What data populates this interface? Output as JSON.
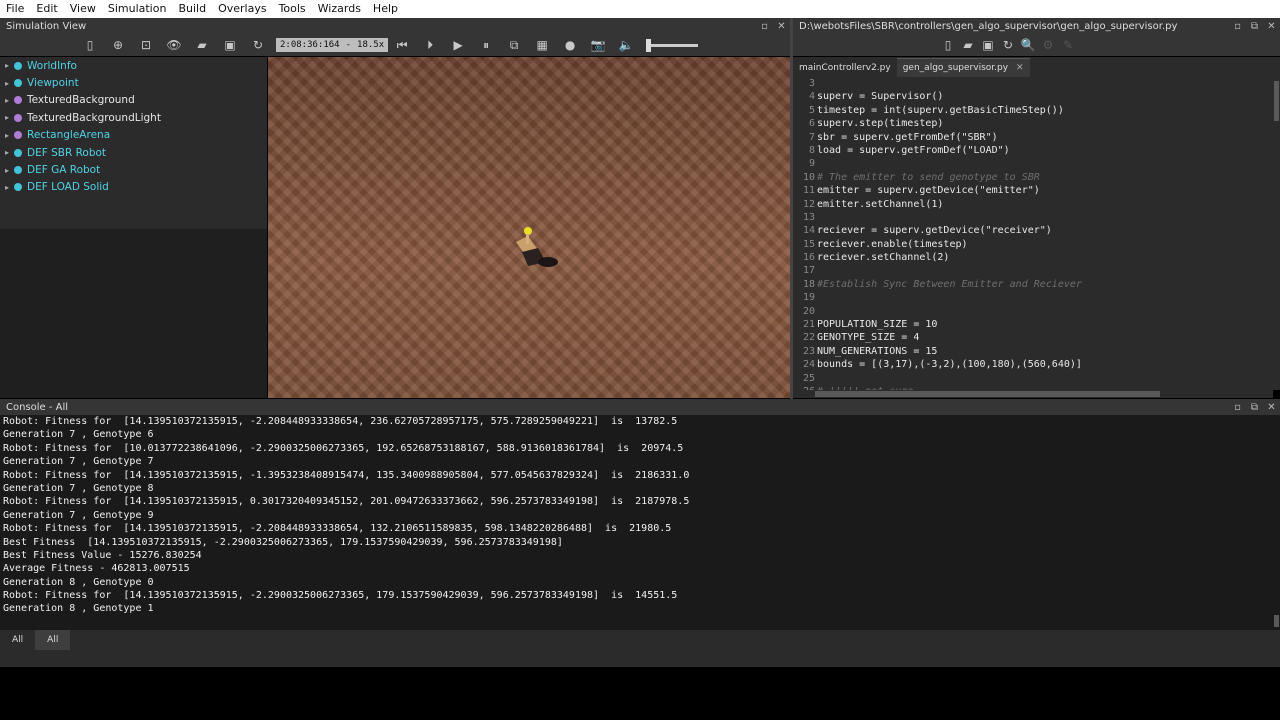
{
  "menubar": [
    "File",
    "Edit",
    "View",
    "Simulation",
    "Build",
    "Overlays",
    "Tools",
    "Wizards",
    "Help"
  ],
  "simulation_view": {
    "title": "Simulation View",
    "time": "2:08:36:164",
    "speed": "18.5x",
    "scene_tree": [
      {
        "label": "WorldInfo",
        "color": "#40c4d8",
        "text_color": "#4fd3e6"
      },
      {
        "label": "Viewpoint",
        "color": "#40c4d8",
        "text_color": "#4fd3e6"
      },
      {
        "label": "TexturedBackground",
        "color": "#b07cd8",
        "text_color": "#e6e6e6"
      },
      {
        "label": "TexturedBackgroundLight",
        "color": "#b07cd8",
        "text_color": "#e6e6e6"
      },
      {
        "label": "RectangleArena",
        "color": "#b07cd8",
        "text_color": "#4fd3e6"
      },
      {
        "label": "DEF SBR Robot",
        "color": "#40c4d8",
        "text_color": "#4fd3e6"
      },
      {
        "label": "DEF GA Robot",
        "color": "#40c4d8",
        "text_color": "#4fd3e6"
      },
      {
        "label": "DEF LOAD Solid",
        "color": "#40c4d8",
        "text_color": "#4fd3e6"
      }
    ]
  },
  "editor": {
    "path": "D:\\webotsFiles\\SBR\\controllers\\gen_algo_supervisor\\gen_algo_supervisor.py",
    "tabs": [
      {
        "label": "mainControllerv2.py",
        "active": false
      },
      {
        "label": "gen_algo_supervisor.py",
        "active": true
      }
    ],
    "lines": [
      {
        "n": "3",
        "text": "",
        "comment": false
      },
      {
        "n": "4",
        "text": "superv = Supervisor()",
        "comment": false
      },
      {
        "n": "5",
        "text": "timestep = int(superv.getBasicTimeStep())",
        "comment": false
      },
      {
        "n": "6",
        "text": "superv.step(timestep)",
        "comment": false
      },
      {
        "n": "7",
        "text": "sbr = superv.getFromDef(\"SBR\")",
        "comment": false
      },
      {
        "n": "8",
        "text": "load = superv.getFromDef(\"LOAD\")",
        "comment": false
      },
      {
        "n": "9",
        "text": "",
        "comment": false
      },
      {
        "n": "10",
        "text": "# The emitter to send genotype to SBR",
        "comment": true
      },
      {
        "n": "11",
        "text": "emitter = superv.getDevice(\"emitter\")",
        "comment": false
      },
      {
        "n": "12",
        "text": "emitter.setChannel(1)",
        "comment": false
      },
      {
        "n": "13",
        "text": "",
        "comment": false
      },
      {
        "n": "14",
        "text": "reciever = superv.getDevice(\"receiver\")",
        "comment": false
      },
      {
        "n": "15",
        "text": "reciever.enable(timestep)",
        "comment": false
      },
      {
        "n": "16",
        "text": "reciever.setChannel(2)",
        "comment": false
      },
      {
        "n": "17",
        "text": "",
        "comment": false
      },
      {
        "n": "18",
        "text": "#Establish Sync Between Emitter and Reciever",
        "comment": true
      },
      {
        "n": "19",
        "text": "",
        "comment": false
      },
      {
        "n": "20",
        "text": "",
        "comment": false
      },
      {
        "n": "21",
        "text": "POPULATION_SIZE = 10",
        "comment": false
      },
      {
        "n": "22",
        "text": "GENOTYPE_SIZE = 4",
        "comment": false
      },
      {
        "n": "23",
        "text": "NUM_GENERATIONS = 15",
        "comment": false
      },
      {
        "n": "24",
        "text": "bounds = [(3,17),(-3,2),(100,180),(560,640)]",
        "comment": false
      },
      {
        "n": "25",
        "text": "",
        "comment": false
      },
      {
        "n": "26",
        "text": "# !!!!! not sure",
        "comment": true
      }
    ]
  },
  "console": {
    "title": "Console - All",
    "lines": [
      "Robot: Fitness for  [14.139510372135915, -2.208448933338654, 236.62705728957175, 575.7289259049221]  is  13782.5",
      "Generation 7 , Genotype 6",
      "Robot: Fitness for  [10.013772238641096, -2.2900325006273365, 192.65268753188167, 588.9136018361784]  is  20974.5",
      "Generation 7 , Genotype 7",
      "Robot: Fitness for  [14.139510372135915, -1.3953238408915474, 135.3400988905804, 577.0545637829324]  is  2186331.0",
      "Generation 7 , Genotype 8",
      "Robot: Fitness for  [14.139510372135915, 0.3017320409345152, 201.09472633373662, 596.2573783349198]  is  2187978.5",
      "Generation 7 , Genotype 9",
      "Robot: Fitness for  [14.139510372135915, -2.208448933338654, 132.2106511589835, 598.1348220286488]  is  21980.5",
      "Best Fitness  [14.139510372135915, -2.2900325006273365, 179.1537590429039, 596.2573783349198]",
      "Best Fitness Value - 15276.830254",
      "Average Fitness - 462813.007515",
      "Generation 8 , Genotype 0",
      "Robot: Fitness for  [14.139510372135915, -2.2900325006273365, 179.1537590429039, 596.2573783349198]  is  14551.5",
      "Generation 8 , Genotype 1"
    ],
    "tabs": [
      "All",
      "All"
    ]
  }
}
